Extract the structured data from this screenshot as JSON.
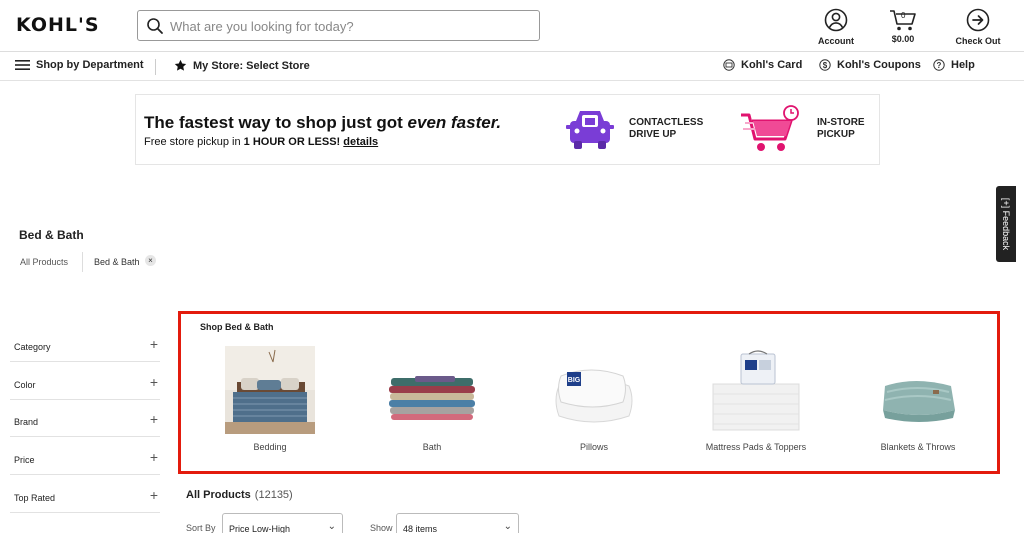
{
  "brand": {
    "logo_text": "KOHL'S",
    "accent_red": "#e31b0d",
    "promo_purple": "#7a3dd6",
    "promo_pink": "#e0136f"
  },
  "header": {
    "search_placeholder": "What are you looking for today?",
    "account_label": "Account",
    "cart_count": "0",
    "cart_total": "$0.00",
    "checkout_label": "Check Out"
  },
  "nav": {
    "shop_by_department": "Shop by Department",
    "my_store": "My Store: Select Store",
    "kohls_card": "Kohl's Card",
    "kohls_coupons": "Kohl's Coupons",
    "help": "Help"
  },
  "promo": {
    "headline_main": "The fastest way to shop just got ",
    "headline_emph": "even faster.",
    "sub_main": "Free store pickup in ",
    "sub_bold": "1 HOUR OR LESS!",
    "sub_link": "details",
    "option1_line1": "CONTACTLESS",
    "option1_line2": "DRIVE UP",
    "option2_line1": "IN-STORE",
    "option2_line2": "PICKUP"
  },
  "feedback_label": "[+] Feedback",
  "page": {
    "title": "Bed & Bath",
    "breadcrumb_all": "All Products",
    "breadcrumb_current": "Bed & Bath",
    "chip_close": "×"
  },
  "filters": [
    {
      "label": "Category",
      "icon": "+"
    },
    {
      "label": "Color",
      "icon": "+"
    },
    {
      "label": "Brand",
      "icon": "+"
    },
    {
      "label": "Price",
      "icon": "+"
    },
    {
      "label": "Top Rated",
      "icon": "+"
    }
  ],
  "shop": {
    "title": "Shop Bed & Bath",
    "tiles": [
      {
        "label": "Bedding",
        "icon": "bedding-photo"
      },
      {
        "label": "Bath",
        "icon": "towels-photo"
      },
      {
        "label": "Pillows",
        "icon": "pillow-photo"
      },
      {
        "label": "Mattress Pads & Toppers",
        "icon": "mattress-pad-photo"
      },
      {
        "label": "Blankets & Throws",
        "icon": "blanket-photo"
      }
    ]
  },
  "results": {
    "all_products_label": "All Products",
    "count": "(12135)",
    "sort_label": "Sort By",
    "sort_value": "Price Low-High",
    "show_label": "Show",
    "show_value": "48 items",
    "chevron": "⌄"
  }
}
